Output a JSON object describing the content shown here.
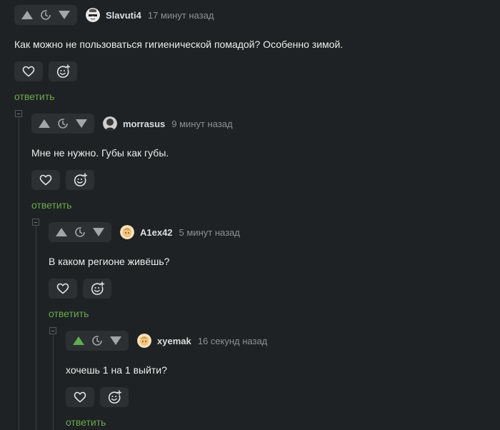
{
  "colors": {
    "background": "#1f2224",
    "panel": "#2c3033",
    "reply_link": "#6aa84f",
    "upvote_active": "#5fae4b",
    "icon_gray": "#a3a6a8"
  },
  "comments": [
    {
      "username": "Slavuti4",
      "time": "17 минут назад",
      "text": "Как можно не пользоваться гигиенической помадой? Особенно зимой.",
      "reply_label": "ответить",
      "upvoted": false,
      "avatar_icon": "avatar-sunglasses-icon"
    },
    {
      "username": "morrasus",
      "time": "9 минут назад",
      "text": "Мне не нужно. Губы как губы.",
      "reply_label": "ответить",
      "upvoted": false,
      "avatar_icon": "avatar-dark-icon"
    },
    {
      "username": "A1ex42",
      "time": "5 минут назад",
      "text": "В каком регионе живёшь?",
      "reply_label": "ответить",
      "upvoted": false,
      "avatar_icon": "avatar-cartoon-icon"
    },
    {
      "username": "xyemak",
      "time": "16 секунд назад",
      "text": "хочешь 1 на 1 выйти?",
      "reply_label": "ответить",
      "upvoted": true,
      "avatar_icon": "avatar-cartoon-icon"
    }
  ]
}
